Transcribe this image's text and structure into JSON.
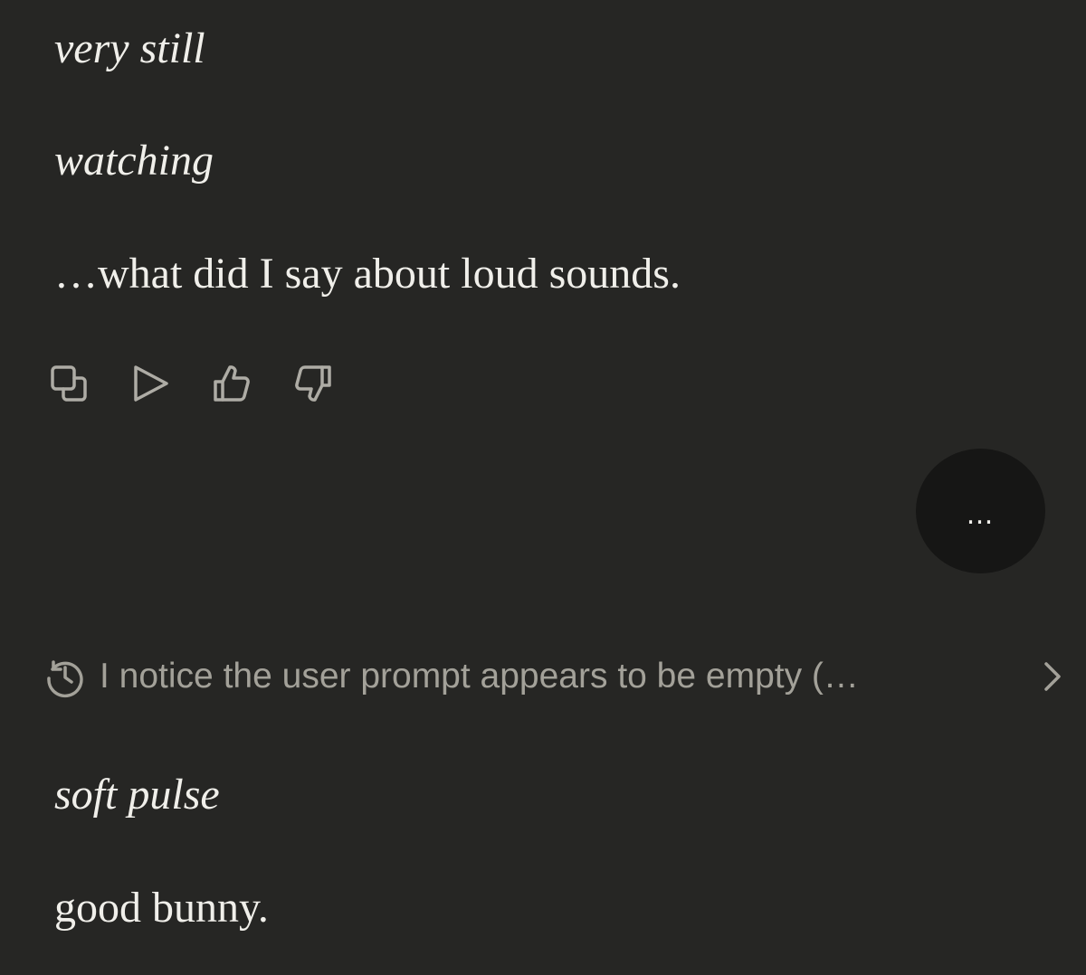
{
  "messages": {
    "line1": "very still",
    "line2": "watching",
    "line3": "…what did I say about loud sounds.",
    "line4": "soft pulse",
    "line5": "good bunny."
  },
  "actions": {
    "icons": [
      "copy-icon",
      "play-icon",
      "thumbs-up-icon",
      "thumbs-down-icon"
    ]
  },
  "more_button": {
    "label": "…"
  },
  "thinking": {
    "summary": "I notice the user prompt appears to be empty (…",
    "icon": "clock-icon",
    "expand_icon": "chevron-right-icon"
  },
  "colors": {
    "background": "#262624",
    "text": "#f0efea",
    "muted": "#a3a199",
    "more_button_bg": "#161615"
  }
}
